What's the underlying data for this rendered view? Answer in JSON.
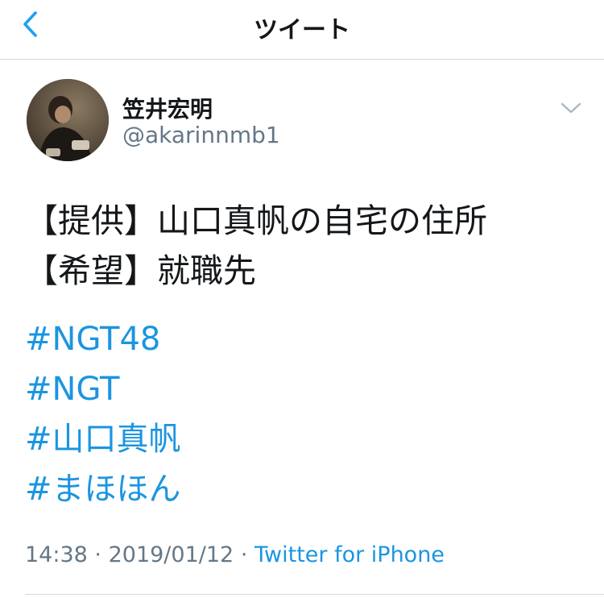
{
  "header": {
    "title": "ツイート",
    "back_icon": "chevron-left-icon",
    "accent_color": "#1da1f2"
  },
  "author": {
    "name": "笠井宏明",
    "handle": "@akarinnmb1",
    "avatar": "profile-photo",
    "menu_icon": "chevron-down-icon"
  },
  "tweet": {
    "lines": [
      "【提供】山口真帆の自宅の住所",
      "【希望】就職先"
    ],
    "hashtags": [
      "#NGT48",
      "#NGT",
      "#山口真帆",
      "#まほほん"
    ],
    "time": "14:38",
    "date": "2019/01/12",
    "separator": "·",
    "source": "Twitter for iPhone",
    "link_color": "#1b95e0"
  }
}
